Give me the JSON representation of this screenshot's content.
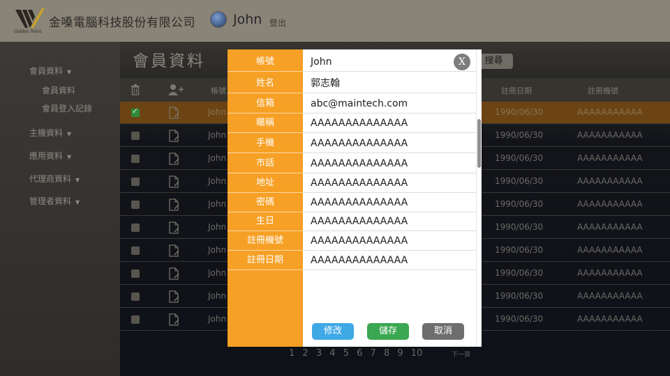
{
  "header": {
    "company_name": "金嗓電腦科技股份有限公司",
    "logo_text": "Golden Voice",
    "username": "John",
    "logout_label": "登出"
  },
  "sidebar": {
    "items": [
      {
        "label": "會員資料"
      },
      {
        "label": "主機資料"
      },
      {
        "label": "應用資料"
      },
      {
        "label": "代理商資料"
      },
      {
        "label": "管理者資料"
      }
    ],
    "subitems": [
      {
        "label": "會員資料"
      },
      {
        "label": "會員登入記錄"
      }
    ]
  },
  "main": {
    "title": "會員資料",
    "search_label": "搜尋",
    "columns": {
      "account": "帳號",
      "reg_date": "註冊日期",
      "reg_device": "註冊機號"
    },
    "rows": [
      {
        "account": "John",
        "date": "1990/06/30",
        "device": "AAAAAAAAAAA",
        "checked": true
      },
      {
        "account": "John",
        "date": "1990/06/30",
        "device": "AAAAAAAAAAA",
        "checked": false
      },
      {
        "account": "John",
        "date": "1990/06/30",
        "device": "AAAAAAAAAAA",
        "checked": false
      },
      {
        "account": "John",
        "date": "1990/06/30",
        "device": "AAAAAAAAAAA",
        "checked": false
      },
      {
        "account": "John",
        "date": "1990/06/30",
        "device": "AAAAAAAAAAA",
        "checked": false
      },
      {
        "account": "John",
        "date": "1990/06/30",
        "device": "AAAAAAAAAAA",
        "checked": false
      },
      {
        "account": "John",
        "date": "1990/06/30",
        "device": "AAAAAAAAAAA",
        "checked": false
      },
      {
        "account": "John",
        "date": "1990/06/30",
        "device": "AAAAAAAAAAA",
        "checked": false
      },
      {
        "account": "John",
        "date": "1990/06/30",
        "device": "AAAAAAAAAAA",
        "checked": false
      },
      {
        "account": "John",
        "date": "1990/06/30",
        "device": "AAAAAAAAAAA",
        "checked": false
      }
    ],
    "pagination": {
      "pages": [
        "1",
        "2",
        "3",
        "4",
        "5",
        "6",
        "7",
        "8",
        "9",
        "10"
      ],
      "next_label": "下一頁"
    }
  },
  "dialog": {
    "close_label": "X",
    "fields": [
      {
        "label": "帳號",
        "value": "John"
      },
      {
        "label": "姓名",
        "value": "郭志翰"
      },
      {
        "label": "信箱",
        "value": "abc@maintech.com"
      },
      {
        "label": "暱稱",
        "value": "AAAAAAAAAAAAAA"
      },
      {
        "label": "手機",
        "value": "AAAAAAAAAAAAAA"
      },
      {
        "label": "市話",
        "value": "AAAAAAAAAAAAAA"
      },
      {
        "label": "地址",
        "value": "AAAAAAAAAAAAAA"
      },
      {
        "label": "密碼",
        "value": "AAAAAAAAAAAAAA"
      },
      {
        "label": "生日",
        "value": "AAAAAAAAAAAAAA"
      },
      {
        "label": "註冊機號",
        "value": "AAAAAAAAAAAAAA"
      },
      {
        "label": "註冊日期",
        "value": "AAAAAAAAAAAAAA"
      }
    ],
    "buttons": {
      "edit": "修改",
      "save": "儲存",
      "cancel": "取消"
    }
  },
  "colors": {
    "accent_orange": "#f6a025",
    "edit_blue": "#3fa9e6",
    "save_green": "#3aa752",
    "cancel_gray": "#6e6e6e",
    "selected_row": "#6c4413"
  }
}
